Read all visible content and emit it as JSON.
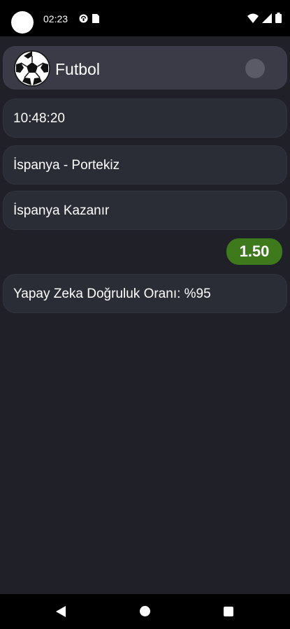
{
  "status_bar": {
    "time": "02:23",
    "icons": [
      "avatar-icon",
      "sync-icon",
      "sim-card-icon",
      "wifi-icon",
      "signal-icon",
      "battery-icon"
    ]
  },
  "header": {
    "title": "Futbol",
    "icon": "soccer-ball-icon",
    "toggle_on": false
  },
  "match": {
    "time": "10:48:20",
    "teams": "İspanya - Portekiz",
    "prediction": "İspanya Kazanır",
    "odds": "1.50",
    "accuracy": "Yapay Zeka Doğruluk Oranı: %95"
  },
  "colors": {
    "background": "#1f2028",
    "card": "#2a2c36",
    "header_card": "#3a3b47",
    "odds_badge": "#3e7a1c"
  },
  "nav_bar": {
    "icons": [
      "back-icon",
      "home-icon",
      "recents-icon"
    ]
  }
}
